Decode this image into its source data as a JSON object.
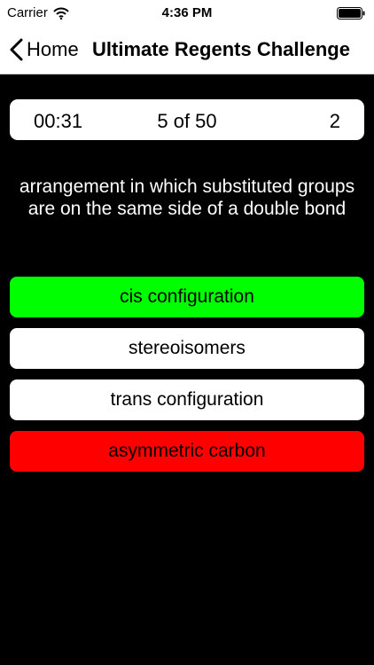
{
  "status_bar": {
    "carrier": "Carrier",
    "time": "4:36 PM"
  },
  "nav": {
    "back_label": "Home",
    "title": "Ultimate Regents Challenge"
  },
  "stats": {
    "timer": "00:31",
    "progress": "5 of 50",
    "score": "2"
  },
  "question": {
    "text": "arrangement in which substituted groups are on the same side of a double bond"
  },
  "answers": [
    {
      "label": "cis configuration",
      "state": "correct",
      "color": "#00ff00"
    },
    {
      "label": "stereoisomers",
      "state": "neutral",
      "color": "#ffffff"
    },
    {
      "label": "trans configuration",
      "state": "neutral",
      "color": "#ffffff"
    },
    {
      "label": "asymmetric carbon",
      "state": "wrong",
      "color": "#ff0000"
    }
  ],
  "icons": {
    "wifi": "wifi-icon",
    "battery": "battery-icon",
    "back": "chevron-left-icon"
  }
}
